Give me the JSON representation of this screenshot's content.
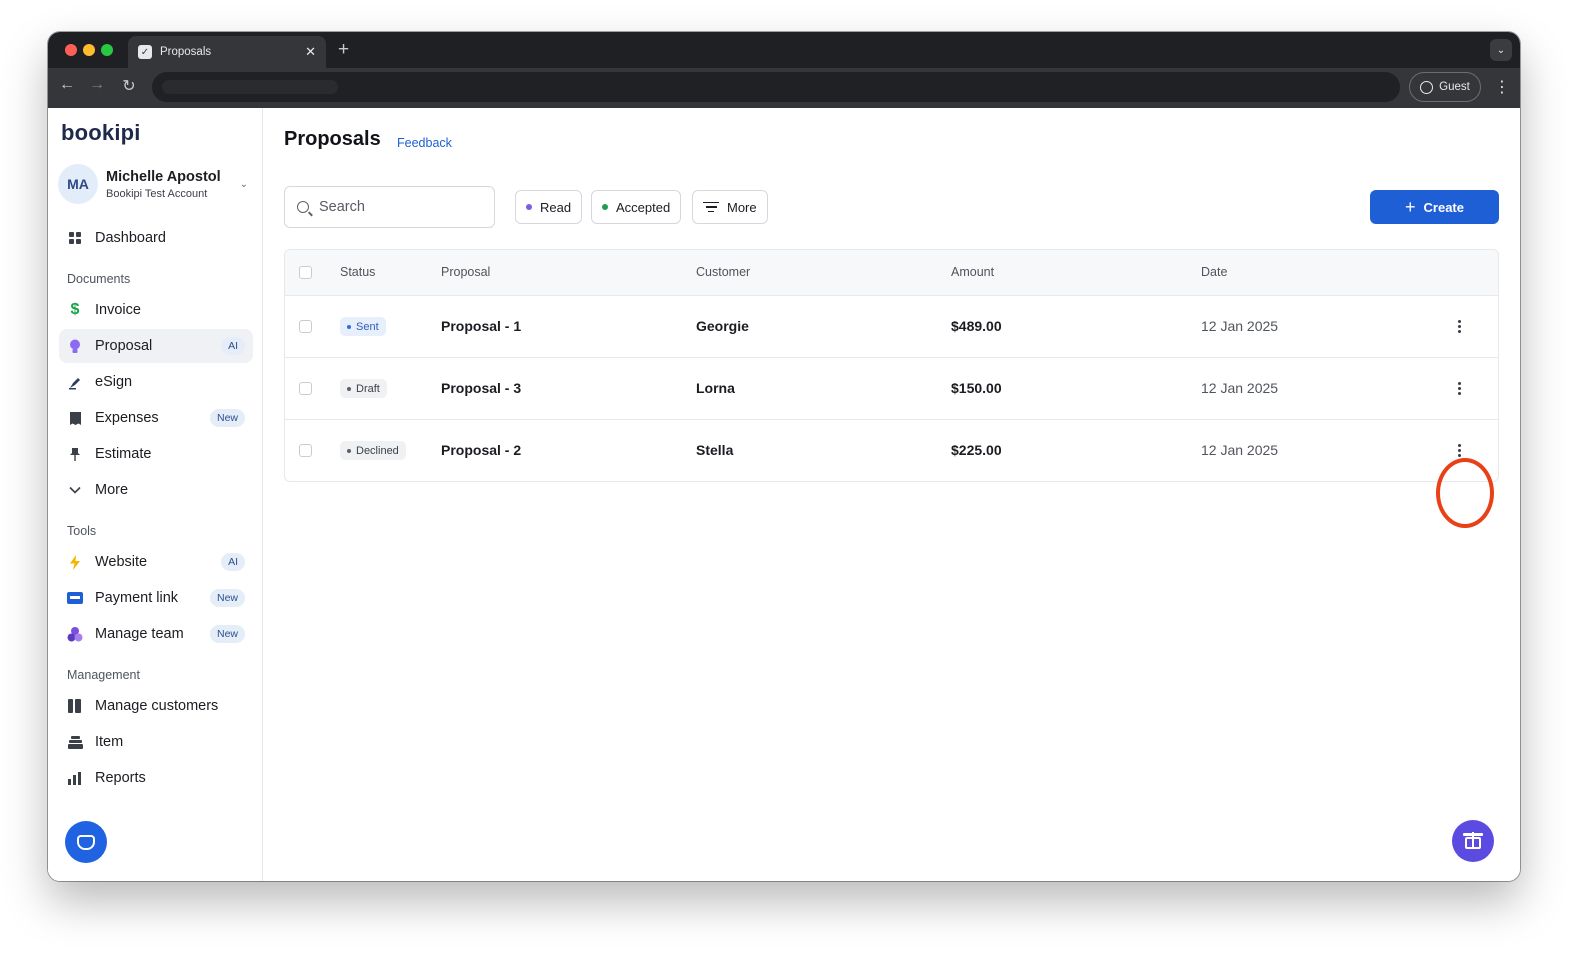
{
  "browser": {
    "tab_title": "Proposals",
    "tab_close": "✕",
    "new_tab": "+",
    "tab_menu": "⌄",
    "nav_back": "←",
    "nav_forward": "→",
    "nav_reload": "↻",
    "profile_label": "Guest",
    "menu_glyph": "⋮"
  },
  "app": {
    "logo": "bookipi",
    "user": {
      "initials": "MA",
      "name": "Michelle Apostol",
      "account": "Bookipi Test Account",
      "chevron": "⌄"
    },
    "sidebar": {
      "dashboard": {
        "label": "Dashboard",
        "icon": "grid-icon"
      },
      "sections": {
        "documents": "Documents",
        "tools": "Tools",
        "management": "Management"
      },
      "documents": [
        {
          "label": "Invoice",
          "icon": "dollar-icon",
          "badge": ""
        },
        {
          "label": "Proposal",
          "icon": "lightbulb-icon",
          "badge": "AI",
          "active": true
        },
        {
          "label": "eSign",
          "icon": "pen-icon",
          "badge": ""
        },
        {
          "label": "Expenses",
          "icon": "receipt-icon",
          "badge": "New"
        },
        {
          "label": "Estimate",
          "icon": "pin-icon",
          "badge": ""
        },
        {
          "label": "More",
          "icon": "chevron-down-icon",
          "badge": ""
        }
      ],
      "tools": [
        {
          "label": "Website",
          "icon": "lightning-icon",
          "badge": "AI"
        },
        {
          "label": "Payment link",
          "icon": "card-icon",
          "badge": "New"
        },
        {
          "label": "Manage team",
          "icon": "team-icon",
          "badge": "New"
        }
      ],
      "management": [
        {
          "label": "Manage customers",
          "icon": "contacts-icon"
        },
        {
          "label": "Item",
          "icon": "stack-icon"
        },
        {
          "label": "Reports",
          "icon": "bar-chart-icon"
        }
      ]
    }
  },
  "main": {
    "title": "Proposals",
    "feedback": "Feedback",
    "search_placeholder": "Search",
    "filters": [
      {
        "label": "Read",
        "dot_color": "#7c5ce0"
      },
      {
        "label": "Accepted",
        "dot_color": "#1f9d55"
      },
      {
        "label": "More"
      }
    ],
    "create_label": "Create",
    "create_icon": "+",
    "table": {
      "columns": [
        "Status",
        "Proposal",
        "Customer",
        "Amount",
        "Date"
      ],
      "rows": [
        {
          "status": "Sent",
          "status_bg": "#e6effb",
          "status_color": "#2c5fb8",
          "dot": "#2c6fe0",
          "proposal": "Proposal - 1",
          "customer": "Georgie",
          "amount": "$489.00",
          "date": "12 Jan 2025"
        },
        {
          "status": "Draft",
          "status_bg": "#f0f1f3",
          "status_color": "#3d4149",
          "dot": "#5b5f67",
          "proposal": "Proposal - 3",
          "customer": "Lorna",
          "amount": "$150.00",
          "date": "12 Jan 2025"
        },
        {
          "status": "Declined",
          "status_bg": "#f0f1f3",
          "status_color": "#3d4149",
          "dot": "#5b5f67",
          "proposal": "Proposal - 2",
          "customer": "Stella",
          "amount": "$225.00",
          "date": "12 Jan 2025"
        }
      ]
    }
  },
  "colors": {
    "accent": "#1f5fd6",
    "highlight_ring": "#e84118",
    "gift_button": "#5b4be0"
  }
}
